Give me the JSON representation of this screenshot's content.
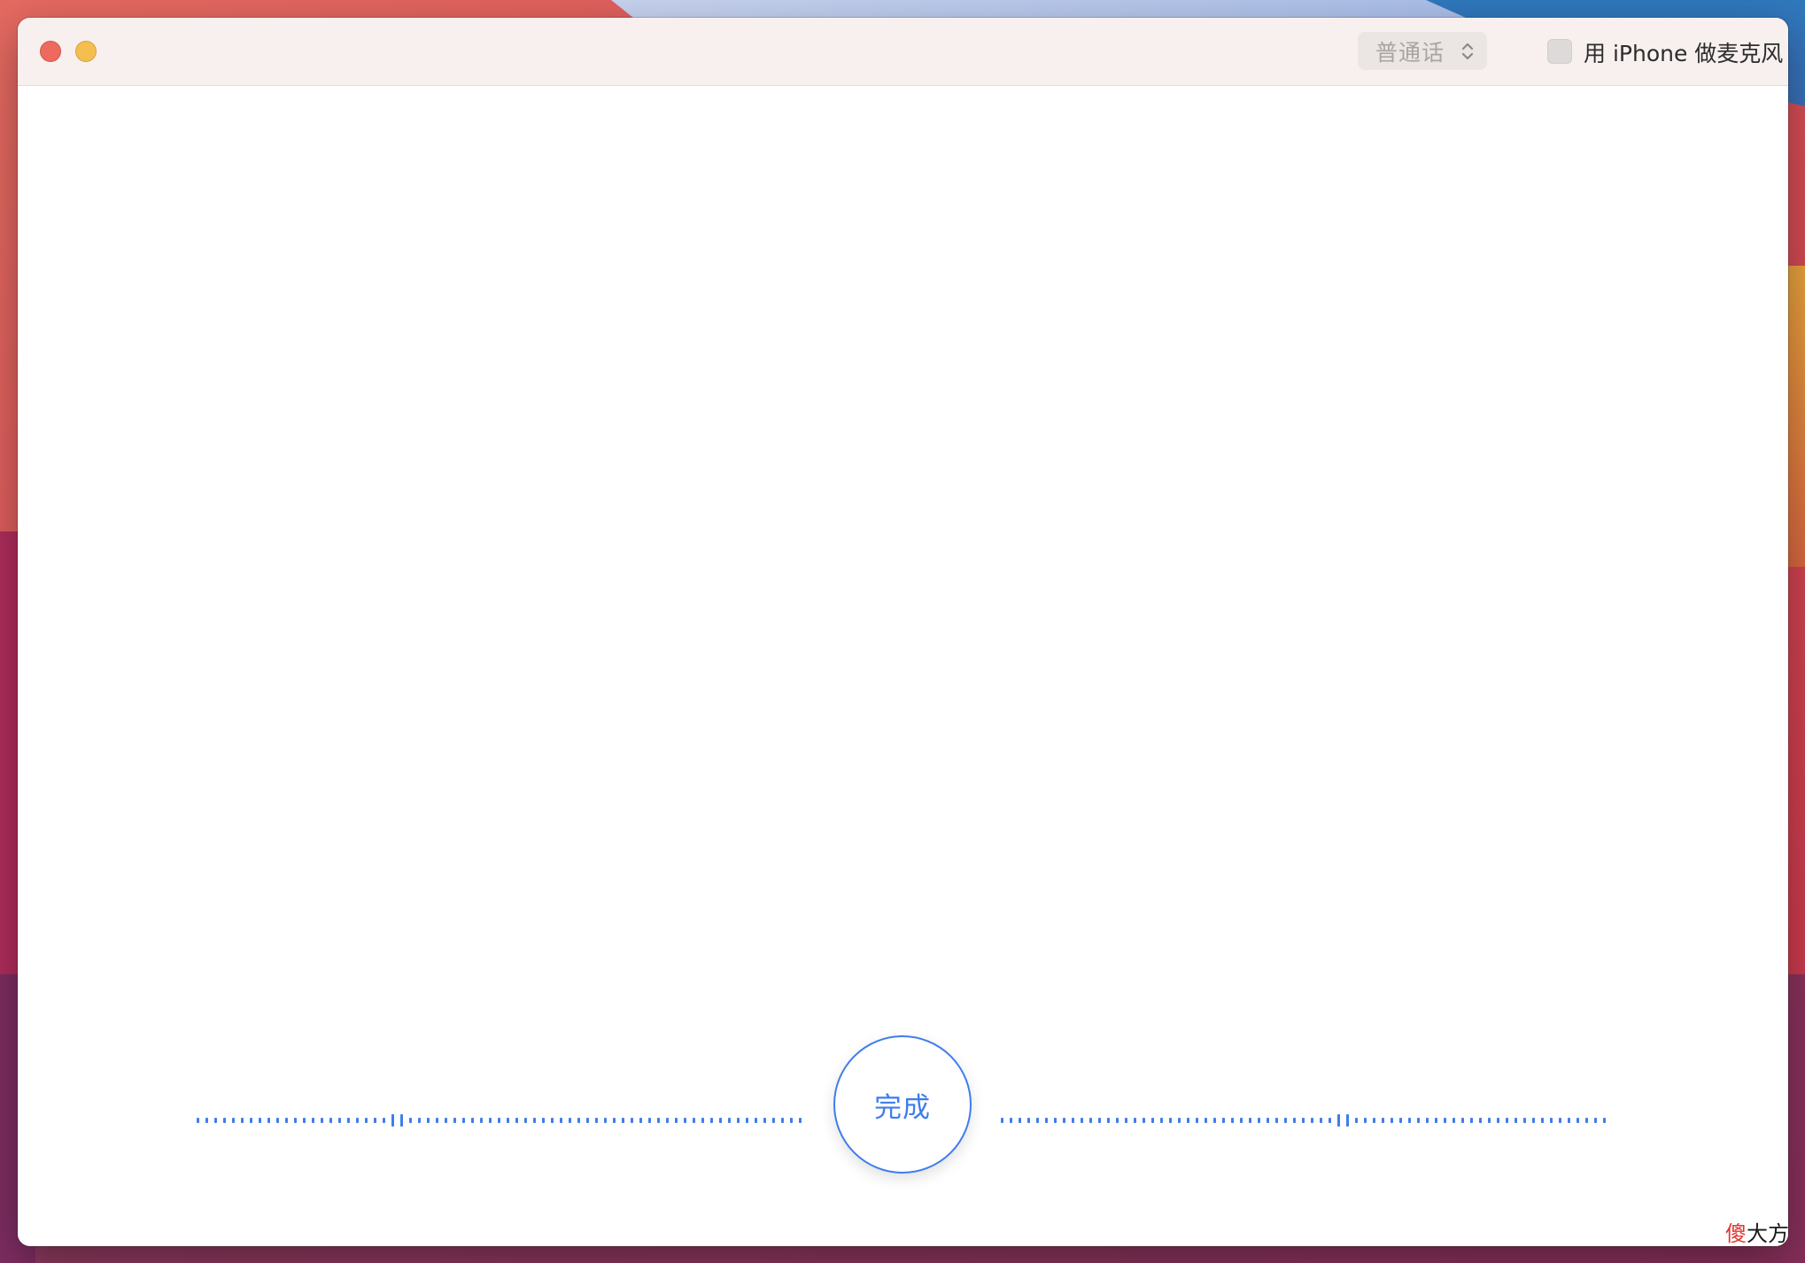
{
  "window": {
    "controls": {
      "close": "close-button",
      "minimize": "minimize-button"
    }
  },
  "toolbar": {
    "language_select": {
      "selected": "普通话",
      "icon": "chevron-up-down-icon"
    },
    "iphone_mic": {
      "label": "用 iPhone 做麦克风",
      "checked": false
    }
  },
  "main": {
    "transcript_text": "",
    "done_button_label": "完成"
  },
  "watermark": {
    "part1": "傻",
    "part2": "大方"
  },
  "colors": {
    "accent": "#3f7ded",
    "titlebar": "#f7f0ef",
    "close": "#ee6a5e",
    "minimize": "#f5bf4f"
  }
}
